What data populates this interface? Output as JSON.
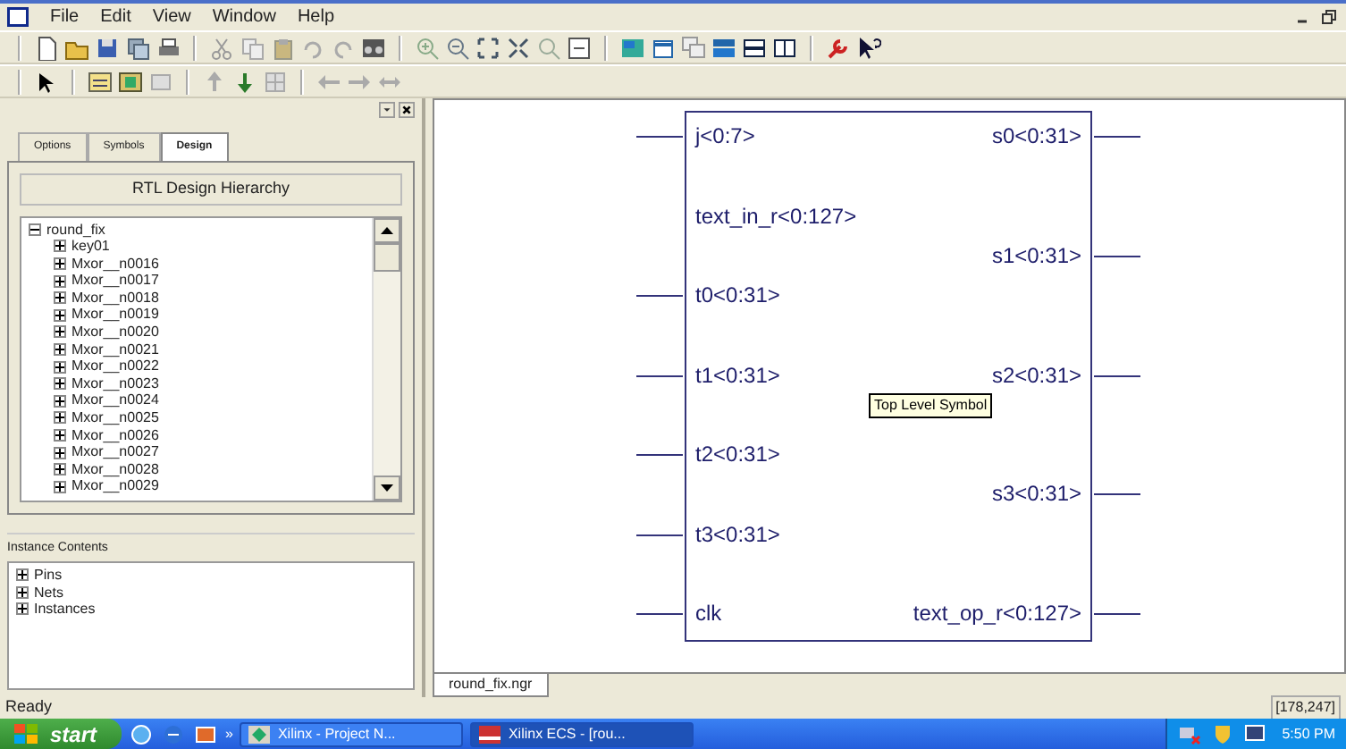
{
  "window": {
    "menu": [
      "File",
      "Edit",
      "View",
      "Window",
      "Help"
    ]
  },
  "panel": {
    "tabs": [
      {
        "label": "Options",
        "selected": false
      },
      {
        "label": "Symbols",
        "selected": false
      },
      {
        "label": "Design",
        "selected": true
      }
    ],
    "header": "RTL Design Hierarchy",
    "tree": [
      {
        "label": "round_fix",
        "expanded": true,
        "children": [
          {
            "label": "key01",
            "expanded": false
          },
          {
            "label": "Mxor__n0016",
            "expanded": false
          },
          {
            "label": "Mxor__n0017",
            "expanded": false
          },
          {
            "label": "Mxor__n0018",
            "expanded": false
          },
          {
            "label": "Mxor__n0019",
            "expanded": false
          },
          {
            "label": "Mxor__n0020",
            "expanded": false
          },
          {
            "label": "Mxor__n0021",
            "expanded": false
          },
          {
            "label": "Mxor__n0022",
            "expanded": false
          },
          {
            "label": "Mxor__n0023",
            "expanded": false
          },
          {
            "label": "Mxor__n0024",
            "expanded": false
          },
          {
            "label": "Mxor__n0025",
            "expanded": false
          },
          {
            "label": "Mxor__n0026",
            "expanded": false
          },
          {
            "label": "Mxor__n0027",
            "expanded": false
          },
          {
            "label": "Mxor__n0028",
            "expanded": false
          },
          {
            "label": "Mxor__n0029",
            "expanded": false
          }
        ]
      }
    ],
    "contents_title": "Instance Contents",
    "contents": [
      {
        "label": "Pins",
        "expanded": false
      },
      {
        "label": "Nets",
        "expanded": false
      },
      {
        "label": "Instances",
        "expanded": false
      }
    ]
  },
  "symbol": {
    "inputs": [
      {
        "label": "j<0:7>",
        "connected": true
      },
      {
        "label": "text_in_r<0:127>",
        "connected": false
      },
      {
        "label": "t0<0:31>",
        "connected": true
      },
      {
        "label": "t1<0:31>",
        "connected": true
      },
      {
        "label": "t2<0:31>",
        "connected": true
      },
      {
        "label": "t3<0:31>",
        "connected": true
      },
      {
        "label": "clk",
        "connected": true
      }
    ],
    "outputs": [
      {
        "label": "s0<0:31>",
        "connected": true
      },
      {
        "label": "s1<0:31>",
        "connected": true
      },
      {
        "label": "s2<0:31>",
        "connected": true
      },
      {
        "label": "s3<0:31>",
        "connected": true
      },
      {
        "label": "text_op_r<0:127>",
        "connected": true
      }
    ],
    "tooltip": "Top Level Symbol"
  },
  "doc_tabs": [
    {
      "label": "round_fix.ngr",
      "selected": true
    }
  ],
  "status_bar": {
    "message": "Ready",
    "coords": "[178,247]"
  },
  "taskbar": {
    "start": "start",
    "more": "»",
    "tasks": [
      {
        "label": "Xilinx - Project N...",
        "selected": false
      },
      {
        "label": "Xilinx ECS - [rou...",
        "selected": true
      }
    ],
    "clock": "5:50 PM"
  }
}
